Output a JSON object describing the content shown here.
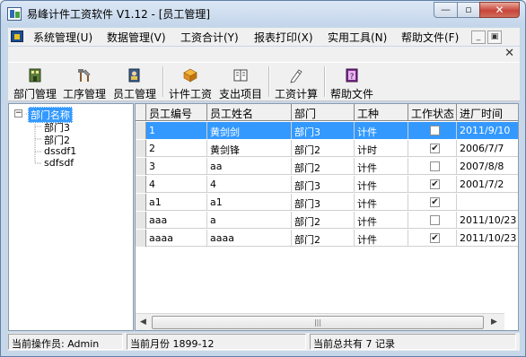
{
  "window": {
    "title": "易峰计件工资软件 V1.12 - [员工管理]"
  },
  "menu": [
    "系统管理(U)",
    "数据管理(V)",
    "工资合计(Y)",
    "报表打印(X)",
    "实用工具(N)",
    "帮助文件(F)"
  ],
  "toolbar": [
    {
      "label": "部门管理",
      "icon": "building-icon"
    },
    {
      "label": "工序管理",
      "icon": "tools-icon"
    },
    {
      "label": "员工管理",
      "icon": "people-icon"
    },
    {
      "label": "计件工资",
      "icon": "cube-icon"
    },
    {
      "label": "支出项目",
      "icon": "ledger-icon"
    },
    {
      "label": "工资计算",
      "icon": "pencil-icon"
    },
    {
      "label": "帮助文件",
      "icon": "help-book-icon"
    }
  ],
  "tree": {
    "root": "部门名称",
    "children": [
      "部门3",
      "部门2",
      "dssdf1",
      "sdfsdf"
    ]
  },
  "grid": {
    "columns": [
      "员工编号",
      "员工姓名",
      "部门",
      "工种",
      "工作状态",
      "进厂时间"
    ],
    "rows": [
      {
        "id": "1",
        "name": "黄剑剑",
        "dept": "部门3",
        "type": "计件",
        "active": false,
        "date": "2011/9/10",
        "selected": true
      },
      {
        "id": "2",
        "name": "黄剑锋",
        "dept": "部门2",
        "type": "计时",
        "active": true,
        "date": "2006/7/7",
        "selected": false
      },
      {
        "id": "3",
        "name": "aa",
        "dept": "部门2",
        "type": "计件",
        "active": false,
        "date": "2007/8/8",
        "selected": false
      },
      {
        "id": "4",
        "name": "4",
        "dept": "部门3",
        "type": "计件",
        "active": true,
        "date": "2001/7/2",
        "selected": false
      },
      {
        "id": "a1",
        "name": "a1",
        "dept": "部门3",
        "type": "计件",
        "active": true,
        "date": "",
        "selected": false
      },
      {
        "id": "aaa",
        "name": "a",
        "dept": "部门2",
        "type": "计件",
        "active": false,
        "date": "2011/10/23",
        "selected": false
      },
      {
        "id": "aaaa",
        "name": "aaaa",
        "dept": "部门2",
        "type": "计件",
        "active": true,
        "date": "2011/10/23",
        "selected": false
      }
    ]
  },
  "status": {
    "operator": "当前操作员: Admin",
    "month": "当前月份 1899-12",
    "count": "当前总共有 7 记录"
  },
  "colors": {
    "selection": "#3399ff",
    "titlebar": "#c7d7ea"
  }
}
